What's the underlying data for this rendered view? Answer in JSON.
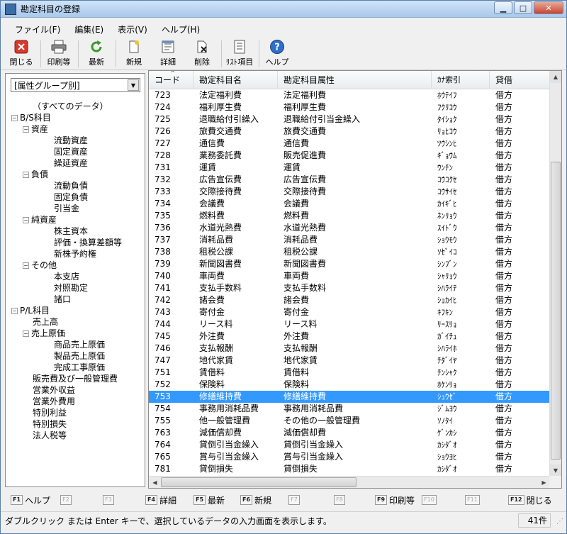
{
  "window": {
    "title": "勘定科目の登録",
    "minimize": "▁",
    "maximize": "□",
    "close": "✕"
  },
  "menu": [
    "ファイル(F)",
    "編集(E)",
    "表示(V)",
    "ヘルプ(H)"
  ],
  "toolbar": {
    "close": "閉じる",
    "print": "印刷等",
    "refresh": "最新",
    "new": "新規",
    "detail": "詳細",
    "delete": "削除",
    "list_items": "ﾘｽﾄ項目",
    "help": "ヘルプ"
  },
  "filter": {
    "selected": "[属性グループ別]"
  },
  "tree": [
    {
      "label": "（すべてのデータ）",
      "depth": 1,
      "expander": ""
    },
    {
      "label": "B/S科目",
      "depth": 0,
      "expander": "−"
    },
    {
      "label": "資産",
      "depth": 1,
      "expander": "−"
    },
    {
      "label": "流動資産",
      "depth": 2,
      "expander": ""
    },
    {
      "label": "固定資産",
      "depth": 2,
      "expander": ""
    },
    {
      "label": "繰延資産",
      "depth": 2,
      "expander": ""
    },
    {
      "label": "負債",
      "depth": 1,
      "expander": "−"
    },
    {
      "label": "流動負債",
      "depth": 2,
      "expander": ""
    },
    {
      "label": "固定負債",
      "depth": 2,
      "expander": ""
    },
    {
      "label": "引当金",
      "depth": 2,
      "expander": ""
    },
    {
      "label": "純資産",
      "depth": 1,
      "expander": "−"
    },
    {
      "label": "株主資本",
      "depth": 2,
      "expander": ""
    },
    {
      "label": "評価・換算差額等",
      "depth": 2,
      "expander": ""
    },
    {
      "label": "新株予約権",
      "depth": 2,
      "expander": ""
    },
    {
      "label": "その他",
      "depth": 1,
      "expander": "−"
    },
    {
      "label": "本支店",
      "depth": 2,
      "expander": ""
    },
    {
      "label": "対照勘定",
      "depth": 2,
      "expander": ""
    },
    {
      "label": "諸口",
      "depth": 2,
      "expander": ""
    },
    {
      "label": "P/L科目",
      "depth": 0,
      "expander": "−"
    },
    {
      "label": "売上高",
      "depth": 1,
      "expander": ""
    },
    {
      "label": "売上原価",
      "depth": 1,
      "expander": "−"
    },
    {
      "label": "商品売上原価",
      "depth": 2,
      "expander": ""
    },
    {
      "label": "製品売上原価",
      "depth": 2,
      "expander": ""
    },
    {
      "label": "完成工事原価",
      "depth": 2,
      "expander": ""
    },
    {
      "label": "販売費及び一般管理費",
      "depth": 1,
      "expander": ""
    },
    {
      "label": "営業外収益",
      "depth": 1,
      "expander": ""
    },
    {
      "label": "営業外費用",
      "depth": 1,
      "expander": ""
    },
    {
      "label": "特別利益",
      "depth": 1,
      "expander": ""
    },
    {
      "label": "特別損失",
      "depth": 1,
      "expander": ""
    },
    {
      "label": "法人税等",
      "depth": 1,
      "expander": ""
    }
  ],
  "table": {
    "columns": [
      "コード",
      "勘定科目名",
      "勘定科目属性",
      "ｶﾅ索引",
      "貸借"
    ],
    "selected_code": "753",
    "rows": [
      [
        "723",
        "法定福利費",
        "法定福利費",
        "ﾎｳﾃｲﾌ",
        "借方"
      ],
      [
        "724",
        "福利厚生費",
        "福利厚生費",
        "ﾌｸﾘｺｳ",
        "借方"
      ],
      [
        "725",
        "退職給付引繰入",
        "退職給付引当金繰入",
        "ﾀｲｼｮｸ",
        "借方"
      ],
      [
        "726",
        "旅費交通費",
        "旅費交通費",
        "ﾘｮﾋｺｳ",
        "借方"
      ],
      [
        "727",
        "通信費",
        "通信費",
        "ﾂｳｼﾝﾋ",
        "借方"
      ],
      [
        "728",
        "業務委託費",
        "販売促進費",
        "ｷﾞｮｳﾑ",
        "借方"
      ],
      [
        "731",
        "運賃",
        "運賃",
        "ｳﾝﾁﾝ",
        "借方"
      ],
      [
        "732",
        "広告宣伝費",
        "広告宣伝費",
        "ｺｳｺｸｾ",
        "借方"
      ],
      [
        "733",
        "交際接待費",
        "交際接待費",
        "ｺｳｻｲｾ",
        "借方"
      ],
      [
        "734",
        "会議費",
        "会議費",
        "ｶｲｷﾞﾋ",
        "借方"
      ],
      [
        "735",
        "燃料費",
        "燃料費",
        "ﾈﾝﾘｮｳ",
        "借方"
      ],
      [
        "736",
        "水道光熱費",
        "水道光熱費",
        "ｽｲﾄﾞｳ",
        "借方"
      ],
      [
        "737",
        "消耗品費",
        "消耗品費",
        "ｼｮｳﾓｳ",
        "借方"
      ],
      [
        "738",
        "租税公課",
        "租税公課",
        "ｿｾﾞｲｺ",
        "借方"
      ],
      [
        "739",
        "新聞図書費",
        "新聞図書費",
        "ｼﾝﾌﾞﾝ",
        "借方"
      ],
      [
        "740",
        "車両費",
        "車両費",
        "ｼｬﾘｮｳ",
        "借方"
      ],
      [
        "741",
        "支払手数料",
        "支払手数料",
        "ｼﾊﾗｲﾃ",
        "借方"
      ],
      [
        "742",
        "諸会費",
        "諸会費",
        "ｼｮｶｲﾋ",
        "借方"
      ],
      [
        "743",
        "寄付金",
        "寄付金",
        "ｷﾌｷﾝ",
        "借方"
      ],
      [
        "744",
        "リース料",
        "リース料",
        "ﾘｰｽﾘｮ",
        "借方"
      ],
      [
        "745",
        "外注費",
        "外注費",
        "ｶﾞｲﾁｭ",
        "借方"
      ],
      [
        "746",
        "支払報酬",
        "支払報酬",
        "ｼﾊﾗｲﾎ",
        "借方"
      ],
      [
        "747",
        "地代家賃",
        "地代家賃",
        "ﾁﾀﾞｲﾔ",
        "借方"
      ],
      [
        "751",
        "賃借料",
        "賃借料",
        "ﾁﾝｼｬｸ",
        "借方"
      ],
      [
        "752",
        "保険料",
        "保険料",
        "ﾎｹﾝﾘｮ",
        "借方"
      ],
      [
        "753",
        "修繕維持費",
        "修繕維持費",
        "ｼｭｳｾﾞ",
        "借方"
      ],
      [
        "754",
        "事務用消耗品費",
        "事務用消耗品費",
        "ｼﾞﾑﾖｳ",
        "借方"
      ],
      [
        "755",
        "他一般管理費",
        "その他の一般管理費",
        "ｿﾉﾀｲ",
        "借方"
      ],
      [
        "763",
        "減価償却費",
        "減価償却費",
        "ｹﾞﾝｶｼ",
        "借方"
      ],
      [
        "764",
        "貸倒引当金繰入",
        "貸倒引当金繰入",
        "ｶｼﾀﾞｵ",
        "借方"
      ],
      [
        "765",
        "賞与引当金繰入",
        "賞与引当金繰入",
        "ｼｮｳﾖﾋ",
        "借方"
      ],
      [
        "781",
        "貸倒損失",
        "貸倒損失",
        "ｶｼﾀﾞｵ",
        "借方"
      ]
    ]
  },
  "fkeys": [
    {
      "key": "F1",
      "label": "ヘルプ",
      "enabled": true
    },
    {
      "key": "F2",
      "label": "",
      "enabled": false
    },
    {
      "key": "F3",
      "label": "",
      "enabled": false
    },
    {
      "key": "F4",
      "label": "詳細",
      "enabled": true
    },
    {
      "key": "F5",
      "label": "最新",
      "enabled": true
    },
    {
      "key": "F6",
      "label": "新規",
      "enabled": true
    },
    {
      "key": "F7",
      "label": "",
      "enabled": false
    },
    {
      "key": "F8",
      "label": "",
      "enabled": false
    },
    {
      "key": "F9",
      "label": "印刷等",
      "enabled": true
    },
    {
      "key": "F10",
      "label": "",
      "enabled": false
    },
    {
      "key": "F11",
      "label": "",
      "enabled": false
    },
    {
      "key": "F12",
      "label": "閉じる",
      "enabled": true
    }
  ],
  "status": {
    "message": "ダブルクリック または Enter キーで、選択しているデータの入力画面を表示します。",
    "count": "41件"
  },
  "colors": {
    "selection": "#3399ff",
    "title_gradient_top": "#cfe3f8",
    "close_button": "#c9452f"
  }
}
